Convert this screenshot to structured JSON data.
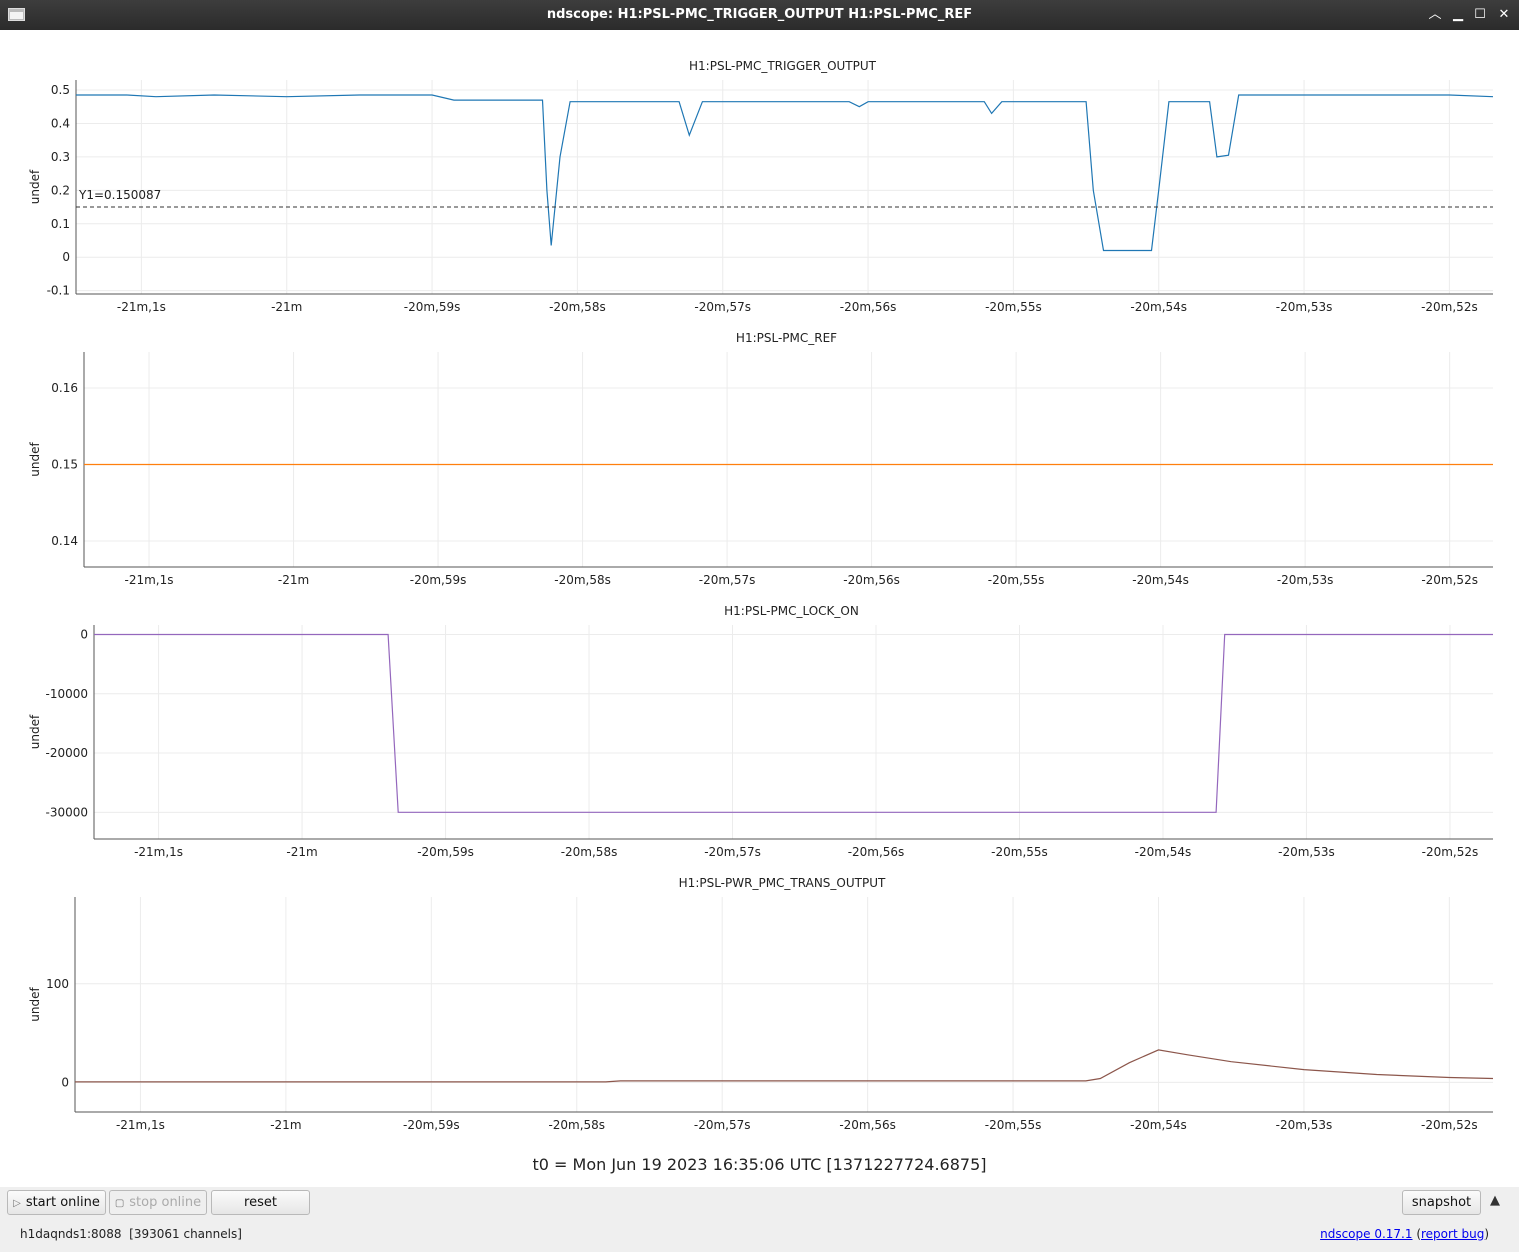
{
  "window": {
    "title": "ndscope: H1:PSL-PMC_TRIGGER_OUTPUT H1:PSL-PMC_REF"
  },
  "t0_label": "t0 = Mon Jun 19 2023 16:35:06 UTC [1371227724.6875]",
  "buttons": {
    "start": "start online",
    "stop": "stop online",
    "reset": "reset",
    "snapshot": "snapshot"
  },
  "status": {
    "server": "h1daqnds1:8088",
    "channels": "[393061 channels]",
    "version": "ndscope 0.17.1",
    "report": "report bug"
  },
  "chart_data": [
    {
      "type": "line",
      "title": "H1:PSL-PMC_TRIGGER_OUTPUT",
      "ylabel": "undef",
      "color": "#1f77b4",
      "xlim": [
        -61.45,
        -51.7
      ],
      "ylim": [
        -0.11,
        0.53
      ],
      "yticks": [
        -0.1,
        0,
        0.1,
        0.2,
        0.3,
        0.4,
        0.5
      ],
      "ytick_labels": [
        "-0.1",
        "0",
        "0.1",
        "0.2",
        "0.3",
        "0.4",
        "0.5"
      ],
      "xticks": [
        -61,
        -60,
        -59,
        -58,
        -57,
        -56,
        -55,
        -54,
        -53,
        -52
      ],
      "xtick_labels": [
        "-21m,1s",
        "-21m",
        "-20m,59s",
        "-20m,58s",
        "-20m,57s",
        "-20m,56s",
        "-20m,55s",
        "-20m,54s",
        "-20m,53s",
        "-20m,52s"
      ],
      "cursor": {
        "y": 0.150087,
        "label": "Y1=0.150087"
      },
      "x": [
        -61.45,
        -61.1,
        -60.9,
        -60.5,
        -60.0,
        -59.5,
        -59.2,
        -59.0,
        -58.85,
        -58.3,
        -58.24,
        -58.21,
        -58.18,
        -58.12,
        -58.05,
        -57.5,
        -57.3,
        -57.23,
        -57.14,
        -56.5,
        -56.13,
        -56.06,
        -56.0,
        -55.94,
        -55.2,
        -55.15,
        -55.08,
        -55.0,
        -54.5,
        -54.45,
        -54.38,
        -54.05,
        -54.0,
        -53.93,
        -53.7,
        -53.65,
        -53.6,
        -53.52,
        -53.45,
        -53.0,
        -52.5,
        -52.0,
        -51.7
      ],
      "y": [
        0.485,
        0.485,
        0.48,
        0.485,
        0.48,
        0.485,
        0.485,
        0.485,
        0.47,
        0.47,
        0.47,
        0.2,
        0.035,
        0.3,
        0.465,
        0.465,
        0.465,
        0.365,
        0.465,
        0.465,
        0.465,
        0.45,
        0.465,
        0.465,
        0.465,
        0.43,
        0.465,
        0.465,
        0.465,
        0.2,
        0.02,
        0.02,
        0.2,
        0.465,
        0.465,
        0.465,
        0.3,
        0.305,
        0.485,
        0.485,
        0.485,
        0.485,
        0.48
      ]
    },
    {
      "type": "line",
      "title": "H1:PSL-PMC_REF",
      "ylabel": "undef",
      "color": "#ff7f0e",
      "xlim": [
        -61.45,
        -51.7
      ],
      "ylim": [
        0.1366,
        0.1647
      ],
      "yticks": [
        0.14,
        0.15,
        0.16
      ],
      "ytick_labels": [
        "0.14",
        "0.15",
        "0.16"
      ],
      "xticks": [
        -61,
        -60,
        -59,
        -58,
        -57,
        -56,
        -55,
        -54,
        -53,
        -52
      ],
      "xtick_labels": [
        "-21m,1s",
        "-21m",
        "-20m,59s",
        "-20m,58s",
        "-20m,57s",
        "-20m,56s",
        "-20m,55s",
        "-20m,54s",
        "-20m,53s",
        "-20m,52s"
      ],
      "x": [
        -61.45,
        -51.7
      ],
      "y": [
        0.15,
        0.15
      ]
    },
    {
      "type": "line",
      "title": "H1:PSL-PMC_LOCK_ON",
      "ylabel": "undef",
      "color": "#9467bd",
      "xlim": [
        -61.45,
        -51.7
      ],
      "ylim": [
        -34500,
        1600
      ],
      "yticks": [
        -30000,
        -20000,
        -10000,
        0
      ],
      "ytick_labels": [
        "-30000",
        "-20000",
        "-10000",
        "0"
      ],
      "xticks": [
        -61,
        -60,
        -59,
        -58,
        -57,
        -56,
        -55,
        -54,
        -53,
        -52
      ],
      "xtick_labels": [
        "-21m,1s",
        "-21m",
        "-20m,59s",
        "-20m,58s",
        "-20m,57s",
        "-20m,56s",
        "-20m,55s",
        "-20m,54s",
        "-20m,53s",
        "-20m,52s"
      ],
      "x": [
        -61.45,
        -59.4,
        -59.33,
        -53.63,
        -53.57,
        -51.7
      ],
      "y": [
        0,
        0,
        -30000,
        -30000,
        0,
        0
      ]
    },
    {
      "type": "line",
      "title": "H1:PSL-PWR_PMC_TRANS_OUTPUT",
      "ylabel": "undef",
      "color": "#8c564b",
      "xlim": [
        -61.45,
        -51.7
      ],
      "ylim": [
        -30,
        188
      ],
      "yticks": [
        0,
        100
      ],
      "ytick_labels": [
        "0",
        "100"
      ],
      "xticks": [
        -61,
        -60,
        -59,
        -58,
        -57,
        -56,
        -55,
        -54,
        -53,
        -52
      ],
      "xtick_labels": [
        "-21m,1s",
        "-21m",
        "-20m,59s",
        "-20m,58s",
        "-20m,57s",
        "-20m,56s",
        "-20m,55s",
        "-20m,54s",
        "-20m,53s",
        "-20m,52s"
      ],
      "x": [
        -61.45,
        -57.8,
        -57.7,
        -54.5,
        -54.4,
        -54.2,
        -54.0,
        -53.8,
        -53.5,
        -53.0,
        -52.5,
        -52.0,
        -51.7
      ],
      "y": [
        0.5,
        0.5,
        1.5,
        1.5,
        4,
        20,
        33,
        28,
        21,
        13,
        8,
        5,
        4
      ]
    }
  ]
}
